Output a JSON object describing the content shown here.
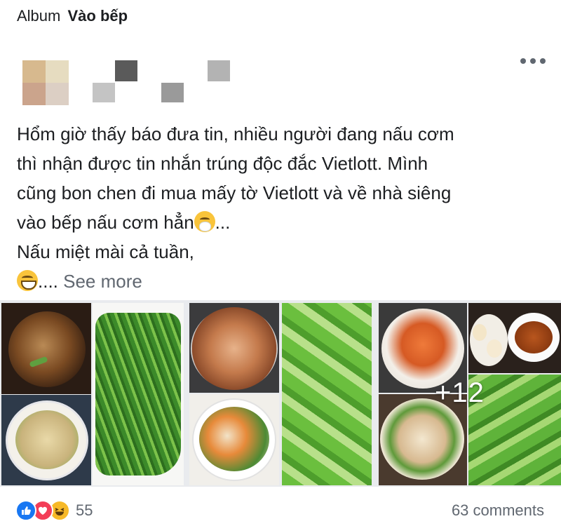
{
  "album": {
    "prefix": "Album",
    "name": "Vào bếp"
  },
  "post": {
    "lines": [
      "Hổm giờ  thấy báo đưa tin, nhiều người đang nấu cơm",
      "thì nhận được tin nhắn trúng độc đắc Vietlott. Mình",
      "cũng bon chen đi mua mấy tờ Vietlott và về nhà siêng",
      "vào bếp nấu cơm hẳn",
      "Nấu miệt mài cả tuần,"
    ],
    "line4_suffix": "...",
    "line6_text": ".... ",
    "see_more": "See more",
    "emojis": [
      "sneezing-face",
      "grinning-face-with-smiling-eyes"
    ]
  },
  "photos": {
    "more_count": "+12",
    "contents": [
      "braised fish",
      "stir-fried water spinach",
      "vegetable soup",
      "shrimp and squid stir-fry",
      "sliced squash",
      "noodle soup with shrimp",
      "grilled shrimp",
      "boiled eggs",
      "dipping sauce",
      "soup bowl",
      "sliced squash"
    ]
  },
  "reactions": {
    "icons": [
      "like-icon",
      "love-icon",
      "haha-icon"
    ],
    "count": "55"
  },
  "comments": {
    "label": "63 comments"
  },
  "colors": {
    "text": "#1c1e21",
    "secondary": "#606770",
    "like": "#1877f2",
    "love": "#f33e58",
    "haha": "#f7b928"
  }
}
